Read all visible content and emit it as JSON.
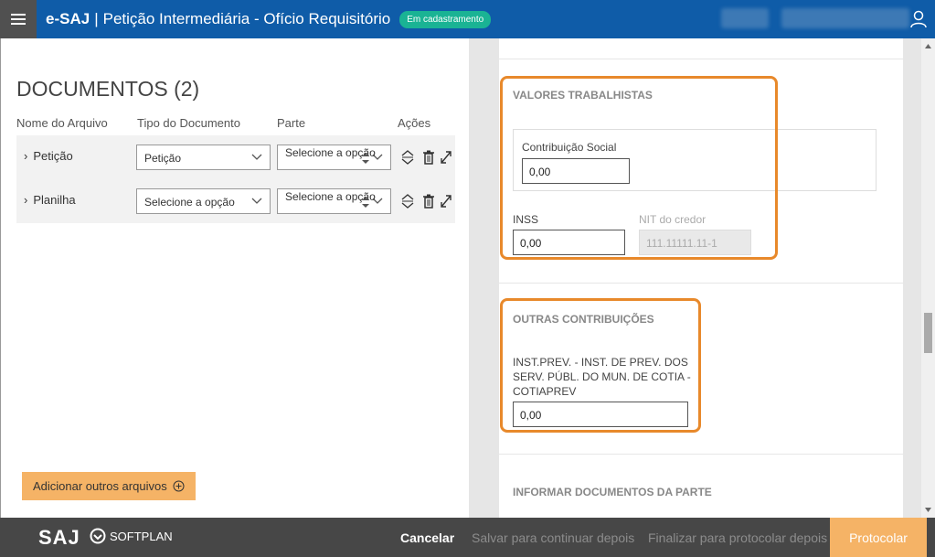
{
  "header": {
    "brand": "e-SAJ",
    "separator": "|",
    "title": "Petição Intermediária - Ofício Requisitório",
    "status": "Em cadastramento"
  },
  "documents": {
    "title": "DOCUMENTOS (2)",
    "columns": {
      "name": "Nome do Arquivo",
      "type": "Tipo do Documento",
      "party": "Parte",
      "actions": "Ações"
    },
    "rows": [
      {
        "name": "Petição",
        "type": "Petição",
        "party": "Selecione a opção"
      },
      {
        "name": "Planilha",
        "type": "Selecione a opção",
        "party": "Selecione a opção"
      }
    ],
    "add_button": "Adicionar outros arquivos"
  },
  "valores_trabalhistas": {
    "title": "VALORES TRABALHISTAS",
    "contribuicao_label": "Contribuição Social",
    "contribuicao_value": "0,00",
    "inss_label": "INSS",
    "inss_value": "0,00",
    "nit_label": "NIT do credor",
    "nit_value": "111.11111.11-1"
  },
  "outras_contribuicoes": {
    "title": "OUTRAS CONTRIBUIÇÕES",
    "field_label": "INST.PREV. - INST. DE PREV. DOS SERV. PÚBL. DO MUN. DE COTIA - COTIAPREV",
    "field_value": "0,00"
  },
  "informar_docs": {
    "title": "INFORMAR DOCUMENTOS DA PARTE"
  },
  "footer": {
    "logo_left": "SAJ",
    "logo_right": "SOFTPLAN",
    "cancel": "Cancelar",
    "save": "Salvar para continuar depois",
    "finalize": "Finalizar para protocolar depois",
    "protocol": "Protocolar"
  },
  "colors": {
    "header_bg": "#0f5ca8",
    "badge": "#1ab394",
    "accent_orange": "#f5b366",
    "highlight_border": "#e8892b",
    "footer_bg": "#474747"
  }
}
